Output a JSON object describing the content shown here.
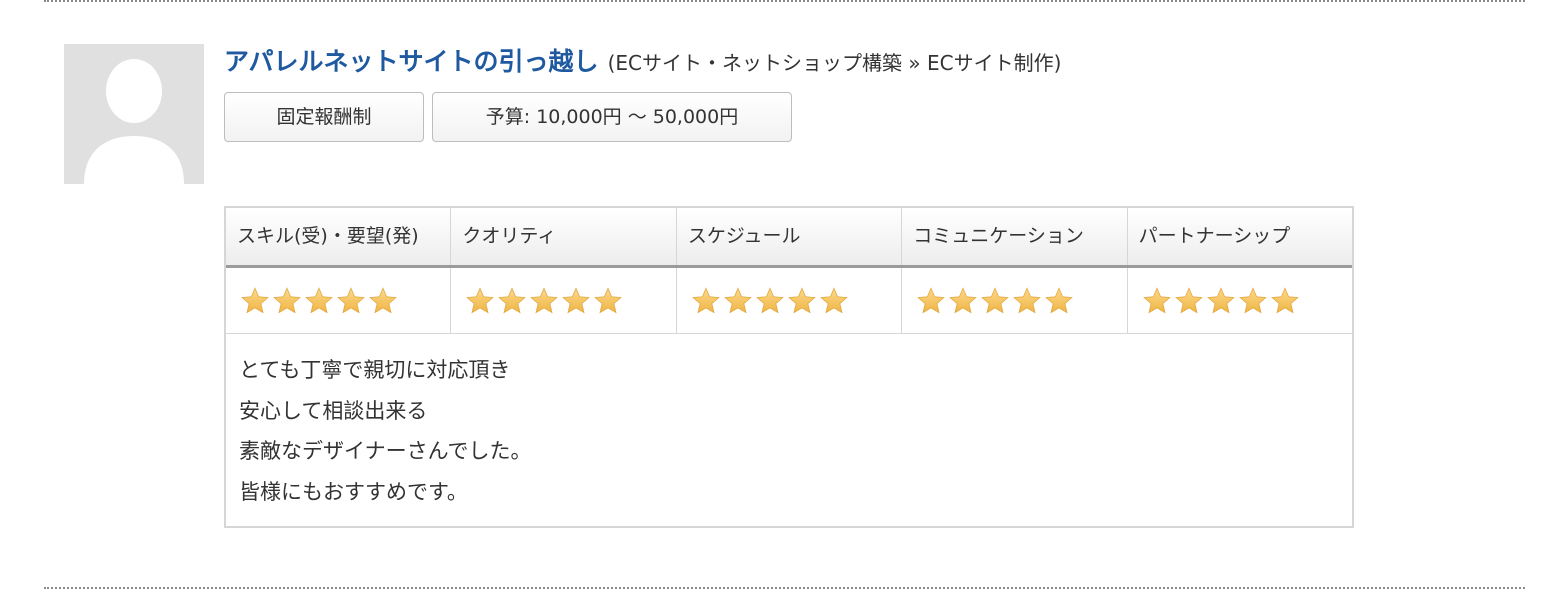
{
  "project": {
    "title": "アパレルネットサイトの引っ越し",
    "category": "(ECサイト・ネットショップ構築 » ECサイト制作)",
    "tags": {
      "pay_type": "固定報酬制",
      "budget": "予算: 10,000円 〜 50,000円"
    }
  },
  "ratings": {
    "items": [
      {
        "label": "スキル(受)・要望(発)",
        "stars": 5
      },
      {
        "label": "クオリティ",
        "stars": 5
      },
      {
        "label": "スケジュール",
        "stars": 5
      },
      {
        "label": "コミュニケーション",
        "stars": 5
      },
      {
        "label": "パートナーシップ",
        "stars": 5
      }
    ],
    "max_stars": 5
  },
  "comment": {
    "lines": [
      "とても丁寧で親切に対応頂き",
      "安心して相談出来る",
      "素敵なデザイナーさんでした。",
      "皆様にもおすすめです。"
    ]
  },
  "colors": {
    "title": "#1f5aa0",
    "star": "#f0b545",
    "avatar_bg": "#e0e0e0"
  },
  "icons": {
    "avatar": "default-user-avatar-icon",
    "star": "star-icon"
  }
}
